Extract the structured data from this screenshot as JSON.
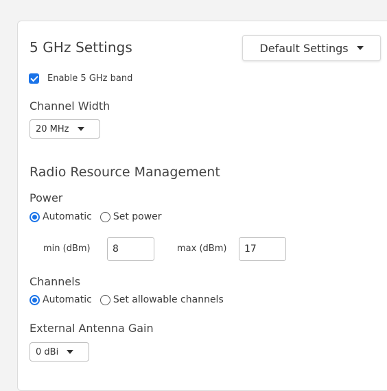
{
  "panel": {
    "title": "5 GHz Settings",
    "preset_dropdown": {
      "selected": "Default Settings"
    },
    "enable_band": {
      "label": "Enable 5 GHz band",
      "checked": true
    },
    "channel_width": {
      "label": "Channel Width",
      "selected": "20 MHz"
    },
    "rrm": {
      "heading": "Radio Resource Management",
      "power": {
        "label": "Power",
        "options": [
          {
            "label": "Automatic",
            "selected": true
          },
          {
            "label": "Set power",
            "selected": false
          }
        ],
        "min": {
          "label": "min (dBm)",
          "value": "8"
        },
        "max": {
          "label": "max (dBm)",
          "value": "17"
        }
      },
      "channels": {
        "label": "Channels",
        "options": [
          {
            "label": "Automatic",
            "selected": true
          },
          {
            "label": "Set allowable channels",
            "selected": false
          }
        ]
      }
    },
    "antenna_gain": {
      "label": "External Antenna Gain",
      "selected": "0 dBi"
    }
  },
  "colors": {
    "accent": "#1a73e8",
    "panel_bg": "#ffffff",
    "page_bg": "#f3f3f3"
  }
}
